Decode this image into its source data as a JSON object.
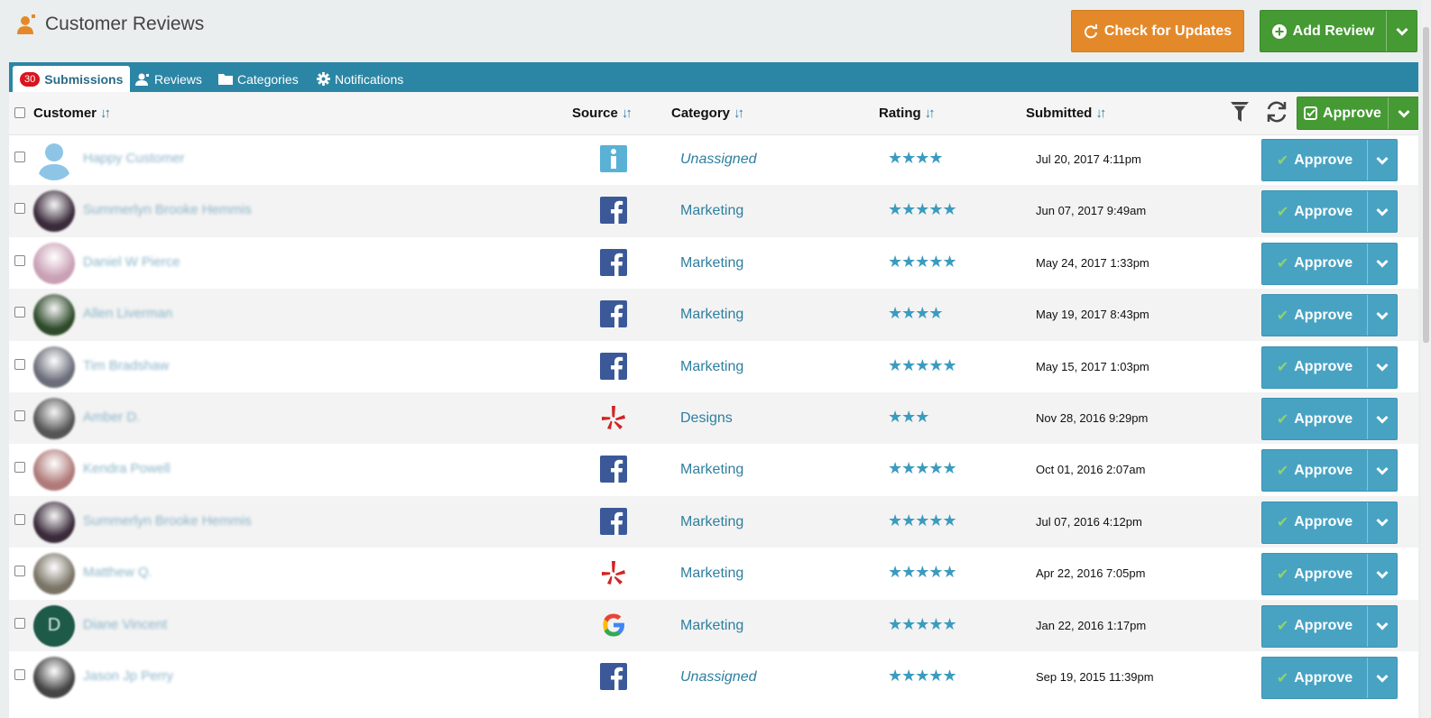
{
  "app": {
    "title": "Customer Reviews"
  },
  "header": {
    "check_updates_label": "Check for Updates",
    "add_review_label": "Add Review"
  },
  "tabs": [
    {
      "label": "Submissions",
      "badge": "30",
      "active": true,
      "icon": "user-badge-icon"
    },
    {
      "label": "Reviews",
      "icon": "user-icon"
    },
    {
      "label": "Categories",
      "icon": "folder-icon"
    },
    {
      "label": "Notifications",
      "icon": "gear-icon"
    }
  ],
  "table": {
    "columns": {
      "customer": "Customer",
      "source": "Source",
      "category": "Category",
      "rating": "Rating",
      "submitted": "Submitted"
    },
    "approve_all_label": "Approve",
    "approve_label": "Approve",
    "rows": [
      {
        "customer": "Happy Customer",
        "source": "info",
        "category": "Unassigned",
        "category_italic": true,
        "rating": 4,
        "submitted": "Jul 20, 2017 4:11pm",
        "avatar": "placeholder"
      },
      {
        "customer": "Summerlyn Brooke Hemmis",
        "source": "facebook",
        "category": "Marketing",
        "rating": 5,
        "submitted": "Jun 07, 2017 9:49am",
        "avatar": "#3a2a3a"
      },
      {
        "customer": "Daniel W Pierce",
        "source": "facebook",
        "category": "Marketing",
        "rating": 5,
        "submitted": "May 24, 2017 1:33pm",
        "avatar": "#c9a0b4"
      },
      {
        "customer": "Allen Liverman",
        "source": "facebook",
        "category": "Marketing",
        "rating": 4,
        "submitted": "May 19, 2017 8:43pm",
        "avatar": "#2e4a2a"
      },
      {
        "customer": "Tim Bradshaw",
        "source": "facebook",
        "category": "Marketing",
        "rating": 5,
        "submitted": "May 15, 2017 1:03pm",
        "avatar": "#6b6e7a"
      },
      {
        "customer": "Amber D.",
        "source": "yelp",
        "category": "Designs",
        "rating": 3,
        "submitted": "Nov 28, 2016 9:29pm",
        "avatar": "#555555"
      },
      {
        "customer": "Kendra Powell",
        "source": "facebook",
        "category": "Marketing",
        "rating": 5,
        "submitted": "Oct 01, 2016 2:07am",
        "avatar": "#b07a7a"
      },
      {
        "customer": "Summerlyn Brooke Hemmis",
        "source": "facebook",
        "category": "Marketing",
        "rating": 5,
        "submitted": "Jul 07, 2016 4:12pm",
        "avatar": "#3a2a3a"
      },
      {
        "customer": "Matthew Q.",
        "source": "yelp",
        "category": "Marketing",
        "rating": 5,
        "submitted": "Apr 22, 2016 7:05pm",
        "avatar": "#7a7466"
      },
      {
        "customer": "Diane Vincent",
        "source": "google",
        "category": "Marketing",
        "rating": 5,
        "submitted": "Jan 22, 2016 1:17pm",
        "avatar": "#1e5a48",
        "avatar_letter": "D"
      },
      {
        "customer": "Jason Jp Perry",
        "source": "facebook",
        "category": "Unassigned",
        "category_italic": true,
        "rating": 5,
        "submitted": "Sep 19, 2015 11:39pm",
        "avatar": "#444444"
      }
    ]
  },
  "colors": {
    "accent": "#2b86a5",
    "approve": "#48a3c3",
    "green": "#459a33",
    "orange": "#e4892a",
    "star": "#3b9bbf",
    "facebook": "#3b5998",
    "yelp": "#d32323"
  }
}
